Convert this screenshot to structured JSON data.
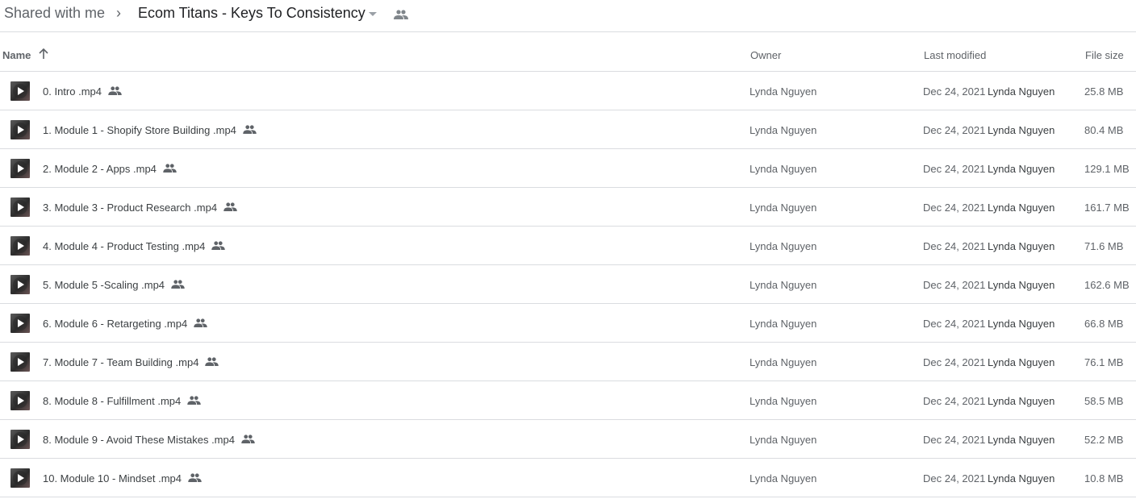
{
  "breadcrumb": {
    "root": "Shared with me",
    "separator": "›",
    "current": "Ecom Titans - Keys To Consistency",
    "caret_icon": "caret-down-icon",
    "shared_icon": "people-icon"
  },
  "columns": {
    "name": "Name",
    "sort_icon": "arrow-up-icon",
    "owner": "Owner",
    "last_modified": "Last modified",
    "file_size": "File size"
  },
  "files": [
    {
      "name": "0. Intro .mp4",
      "owner": "Lynda Nguyen",
      "modified_date": "Dec 24, 2021",
      "modified_by": "Lynda Nguyen",
      "size": "25.8 MB",
      "type_icon": "video-thumbnail-icon",
      "shared": true
    },
    {
      "name": "1. Module 1 - Shopify Store Building .mp4",
      "owner": "Lynda Nguyen",
      "modified_date": "Dec 24, 2021",
      "modified_by": "Lynda Nguyen",
      "size": "80.4 MB",
      "type_icon": "video-thumbnail-icon",
      "shared": true
    },
    {
      "name": "2. Module 2 - Apps .mp4",
      "owner": "Lynda Nguyen",
      "modified_date": "Dec 24, 2021",
      "modified_by": "Lynda Nguyen",
      "size": "129.1 MB",
      "type_icon": "video-thumbnail-icon",
      "shared": true
    },
    {
      "name": "3. Module 3 - Product Research .mp4",
      "owner": "Lynda Nguyen",
      "modified_date": "Dec 24, 2021",
      "modified_by": "Lynda Nguyen",
      "size": "161.7 MB",
      "type_icon": "video-thumbnail-icon",
      "shared": true
    },
    {
      "name": "4. Module 4 - Product Testing .mp4",
      "owner": "Lynda Nguyen",
      "modified_date": "Dec 24, 2021",
      "modified_by": "Lynda Nguyen",
      "size": "71.6 MB",
      "type_icon": "video-thumbnail-icon",
      "shared": true
    },
    {
      "name": "5. Module 5 -Scaling .mp4",
      "owner": "Lynda Nguyen",
      "modified_date": "Dec 24, 2021",
      "modified_by": "Lynda Nguyen",
      "size": "162.6 MB",
      "type_icon": "video-thumbnail-icon",
      "shared": true
    },
    {
      "name": "6. Module 6 - Retargeting .mp4",
      "owner": "Lynda Nguyen",
      "modified_date": "Dec 24, 2021",
      "modified_by": "Lynda Nguyen",
      "size": "66.8 MB",
      "type_icon": "video-thumbnail-icon",
      "shared": true
    },
    {
      "name": "7. Module 7 - Team Building .mp4",
      "owner": "Lynda Nguyen",
      "modified_date": "Dec 24, 2021",
      "modified_by": "Lynda Nguyen",
      "size": "76.1 MB",
      "type_icon": "video-thumbnail-icon",
      "shared": true
    },
    {
      "name": "8. Module 8 - Fulfillment .mp4",
      "owner": "Lynda Nguyen",
      "modified_date": "Dec 24, 2021",
      "modified_by": "Lynda Nguyen",
      "size": "58.5 MB",
      "type_icon": "video-thumbnail-icon",
      "shared": true
    },
    {
      "name": "8. Module 9 - Avoid These Mistakes .mp4",
      "owner": "Lynda Nguyen",
      "modified_date": "Dec 24, 2021",
      "modified_by": "Lynda Nguyen",
      "size": "52.2 MB",
      "type_icon": "video-thumbnail-icon",
      "shared": true
    },
    {
      "name": "10. Module 10 - Mindset .mp4",
      "owner": "Lynda Nguyen",
      "modified_date": "Dec 24, 2021",
      "modified_by": "Lynda Nguyen",
      "size": "10.8 MB",
      "type_icon": "video-thumbnail-icon",
      "shared": true
    }
  ]
}
